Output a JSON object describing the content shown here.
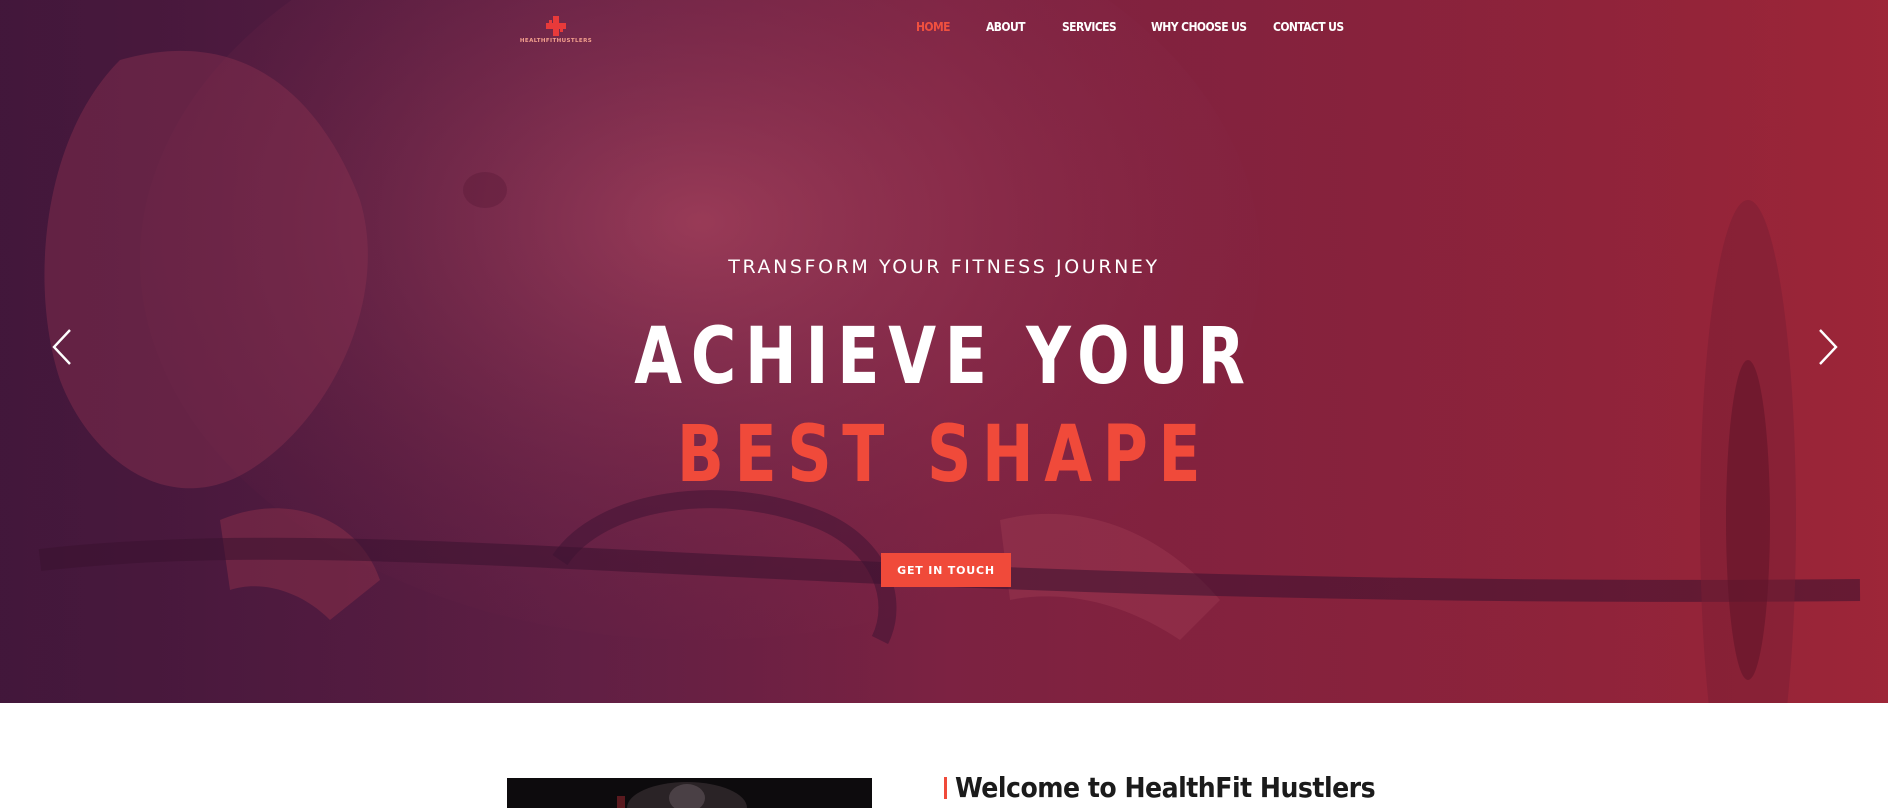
{
  "brand": {
    "name": "HEALTHFITHUSTLERS",
    "logo_icon": "cross-dumbbell-icon",
    "accent_color": "#f04a3a"
  },
  "nav": {
    "items": [
      {
        "label": "HOME",
        "active": true
      },
      {
        "label": "ABOUT",
        "active": false
      },
      {
        "label": "SERVICES",
        "active": false
      },
      {
        "label": "WHY CHOOSE US",
        "active": false
      },
      {
        "label": "CONTACT US",
        "active": false
      }
    ]
  },
  "hero": {
    "subtitle": "TRANSFORM YOUR FITNESS JOURNEY",
    "headline_line1": "ACHIEVE YOUR",
    "headline_line2": "BEST SHAPE",
    "cta_label": "GET IN TOUCH",
    "prev_icon": "chevron-left-icon",
    "next_icon": "chevron-right-icon",
    "overlay_colors": [
      "#4a1a3e",
      "#9a2437"
    ]
  },
  "about": {
    "heading": "Welcome to HealthFit Hustlers"
  }
}
